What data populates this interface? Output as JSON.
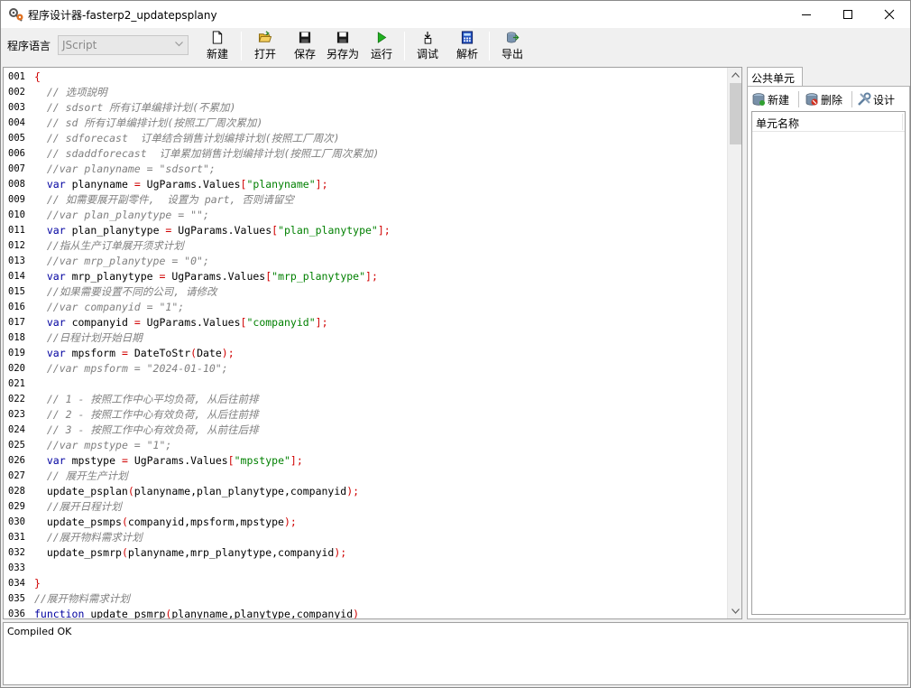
{
  "window": {
    "title": "程序设计器-fasterp2_updatepsplany",
    "minimize_symbol": "—",
    "maximize_symbol": "☐",
    "close_symbol": "✕"
  },
  "toolbar": {
    "language_label": "程序语言",
    "language_value": "JScript",
    "buttons": [
      {
        "label": "新建",
        "icon": "new-file-icon"
      },
      {
        "label": "打开",
        "icon": "open-folder-icon"
      },
      {
        "label": "保存",
        "icon": "save-icon"
      },
      {
        "label": "另存为",
        "icon": "save-as-icon"
      },
      {
        "label": "运行",
        "icon": "run-icon"
      },
      {
        "label": "调试",
        "icon": "debug-icon"
      },
      {
        "label": "解析",
        "icon": "calculator-icon"
      },
      {
        "label": "导出",
        "icon": "export-icon"
      }
    ]
  },
  "editor": {
    "lines": [
      {
        "n": "001",
        "t": "{"
      },
      {
        "n": "002",
        "t": "  // 选项説明"
      },
      {
        "n": "003",
        "t": "  // sdsort 所有订单编排计划(不累加)"
      },
      {
        "n": "004",
        "t": "  // sd 所有订单编排计划(按照工厂周次累加)"
      },
      {
        "n": "005",
        "t": "  // sdforecast  订单结合销售计划编排计划(按照工厂周次)"
      },
      {
        "n": "006",
        "t": "  // sdaddforecast  订单累加销售计划编排计划(按照工厂周次累加)"
      },
      {
        "n": "007",
        "t": "  //var planyname = \"sdsort\";"
      },
      {
        "n": "008",
        "t": "  var planyname = UgParams.Values[\"planyname\"];"
      },
      {
        "n": "009",
        "t": "  // 如需要展开副零件,  设置为 part, 否则请留空"
      },
      {
        "n": "010",
        "t": "  //var plan_planytype = \"\";"
      },
      {
        "n": "011",
        "t": "  var plan_planytype = UgParams.Values[\"plan_planytype\"];"
      },
      {
        "n": "012",
        "t": "  //指从生产订单展开须求计划"
      },
      {
        "n": "013",
        "t": "  //var mrp_planytype = \"0\";"
      },
      {
        "n": "014",
        "t": "  var mrp_planytype = UgParams.Values[\"mrp_planytype\"];"
      },
      {
        "n": "015",
        "t": "  //如果需要设置不同的公司, 请修改"
      },
      {
        "n": "016",
        "t": "  //var companyid = \"1\";"
      },
      {
        "n": "017",
        "t": "  var companyid = UgParams.Values[\"companyid\"];"
      },
      {
        "n": "018",
        "t": "  //日程计划开始日期"
      },
      {
        "n": "019",
        "t": "  var mpsform = DateToStr(Date);"
      },
      {
        "n": "020",
        "t": "  //var mpsform = \"2024-01-10\";"
      },
      {
        "n": "021",
        "t": ""
      },
      {
        "n": "022",
        "t": "  // 1 - 按照工作中心平均负荷, 从后往前排"
      },
      {
        "n": "023",
        "t": "  // 2 - 按照工作中心有效负荷, 从后往前排"
      },
      {
        "n": "024",
        "t": "  // 3 - 按照工作中心有效负荷, 从前往后排"
      },
      {
        "n": "025",
        "t": "  //var mpstype = \"1\";"
      },
      {
        "n": "026",
        "t": "  var mpstype = UgParams.Values[\"mpstype\"];"
      },
      {
        "n": "027",
        "t": "  // 展开生产计划"
      },
      {
        "n": "028",
        "t": "  update_psplan(planyname,plan_planytype,companyid);"
      },
      {
        "n": "029",
        "t": "  //展开日程计划"
      },
      {
        "n": "030",
        "t": "  update_psmps(companyid,mpsform,mpstype);"
      },
      {
        "n": "031",
        "t": "  //展开物料需求计划"
      },
      {
        "n": "032",
        "t": "  update_psmrp(planyname,mrp_planytype,companyid);"
      },
      {
        "n": "033",
        "t": ""
      },
      {
        "n": "034",
        "t": "}"
      },
      {
        "n": "035",
        "t": "//展开物料需求计划"
      },
      {
        "n": "036",
        "t": "function update_psmrp(planyname,planytype,companyid)"
      }
    ]
  },
  "right_panel": {
    "tab": "公共单元",
    "new_label": "新建",
    "delete_label": "删除",
    "design_label": "设计",
    "column_header": "单元名称"
  },
  "status": {
    "message": "Compiled OK"
  }
}
